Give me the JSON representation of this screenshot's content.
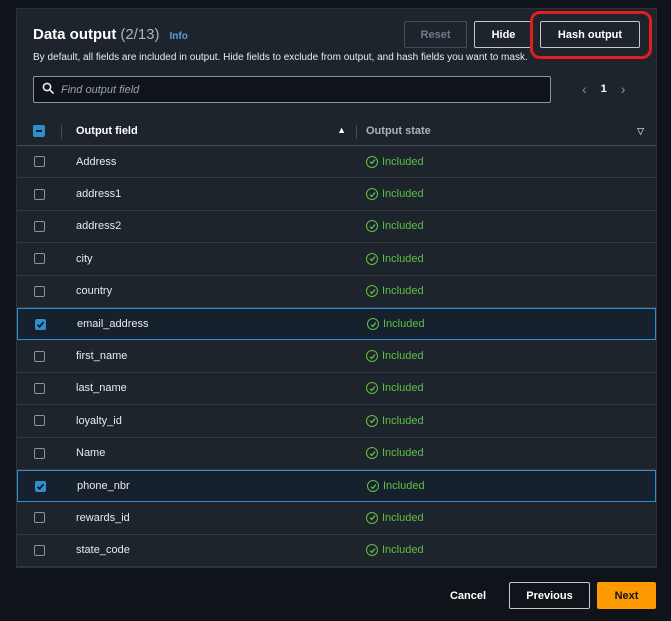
{
  "header": {
    "title": "Data output",
    "count": "(2/13)",
    "info": "Info",
    "description": "By default, all fields are included in output. Hide fields to exclude from output, and hash fields you want to mask."
  },
  "buttons": {
    "reset": "Reset",
    "hide": "Hide",
    "hash": "Hash output"
  },
  "search": {
    "placeholder": "Find output field"
  },
  "pager": {
    "page": "1"
  },
  "table": {
    "col_field": "Output field",
    "col_state": "Output state",
    "rows": [
      {
        "field": "Address",
        "state": "Included",
        "checked": false
      },
      {
        "field": "address1",
        "state": "Included",
        "checked": false
      },
      {
        "field": "address2",
        "state": "Included",
        "checked": false
      },
      {
        "field": "city",
        "state": "Included",
        "checked": false
      },
      {
        "field": "country",
        "state": "Included",
        "checked": false
      },
      {
        "field": "email_address",
        "state": "Included",
        "checked": true
      },
      {
        "field": "first_name",
        "state": "Included",
        "checked": false
      },
      {
        "field": "last_name",
        "state": "Included",
        "checked": false
      },
      {
        "field": "loyalty_id",
        "state": "Included",
        "checked": false
      },
      {
        "field": "Name",
        "state": "Included",
        "checked": false
      },
      {
        "field": "phone_nbr",
        "state": "Included",
        "checked": true
      },
      {
        "field": "rewards_id",
        "state": "Included",
        "checked": false
      },
      {
        "field": "state_code",
        "state": "Included",
        "checked": false
      }
    ]
  },
  "footer": {
    "cancel": "Cancel",
    "previous": "Previous",
    "next": "Next"
  },
  "colors": {
    "accent": "#ff9900",
    "included": "#5fbf46",
    "selection": "#2d8fcf",
    "highlight": "#e11d1d"
  }
}
